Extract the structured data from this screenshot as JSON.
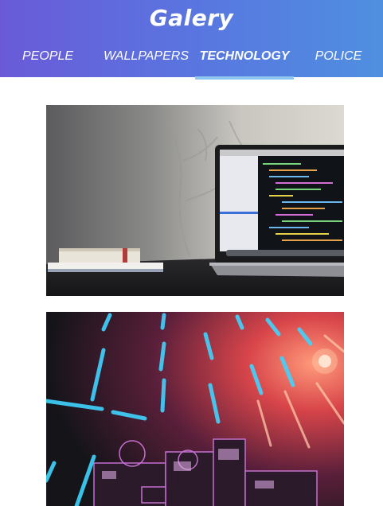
{
  "app": {
    "title": "Galery"
  },
  "tabs": [
    {
      "label": "PEOPLE",
      "active": false
    },
    {
      "label": "WALLPAPERS",
      "active": false
    },
    {
      "label": "TECHNOLOGY",
      "active": true
    },
    {
      "label": "POLICE",
      "active": false
    }
  ],
  "photos": [
    {
      "subject": "laptop-on-desk"
    },
    {
      "subject": "stage-lights-equipment"
    }
  ],
  "colors": {
    "header_start": "#6a5ad8",
    "header_end": "#4f8fe0",
    "tab_indicator": "#8ec6f2",
    "background": "#ffffff"
  }
}
